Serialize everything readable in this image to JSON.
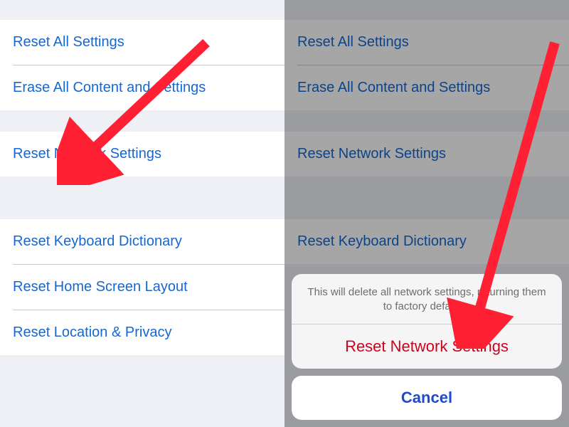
{
  "left": {
    "items": [
      "Reset All Settings",
      "Erase All Content and Settings",
      "Reset Network Settings",
      "Reset Keyboard Dictionary",
      "Reset Home Screen Layout",
      "Reset Location & Privacy"
    ]
  },
  "right": {
    "items": [
      "Reset All Settings",
      "Erase All Content and Settings",
      "Reset Network Settings",
      "Reset Keyboard Dictionary"
    ],
    "sheet": {
      "message": "This will delete all network settings, returning them to factory defaults.",
      "confirm": "Reset Network Settings",
      "cancel": "Cancel"
    }
  },
  "annotations": {
    "arrow_color": "#ff2133"
  }
}
